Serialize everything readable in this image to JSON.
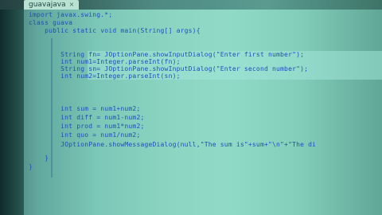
{
  "tab": {
    "label": "guavajava",
    "close": "×"
  },
  "code_lines": [
    "import javax.swing.*;",
    "class guava",
    "    public static void main(String[] args){",
    "",
    "        String fn= JOptionPane.showInputDialog(\"Enter first number\");",
    "        int num1=Integer.parseInt(fn);",
    "        String sn= JOptionPane.showInputDialog(\"Enter second number\");",
    "        int num2=Integer.parseInt(sn);",
    "",
    "",
    "        int sum = num1+num2;",
    "        int diff = num1-num2;",
    "        int prod = num1*num2;",
    "        int quo = num1/num2;",
    "        JOptionPane.showMessageDialog(null,\"The sum is\"+sum+\"\\n\"+\"The di",
    "    }",
    "}"
  ],
  "colors": {
    "text": "#1f4fb8",
    "background": "#7dd2bc",
    "tab": "#b9e2d3"
  }
}
